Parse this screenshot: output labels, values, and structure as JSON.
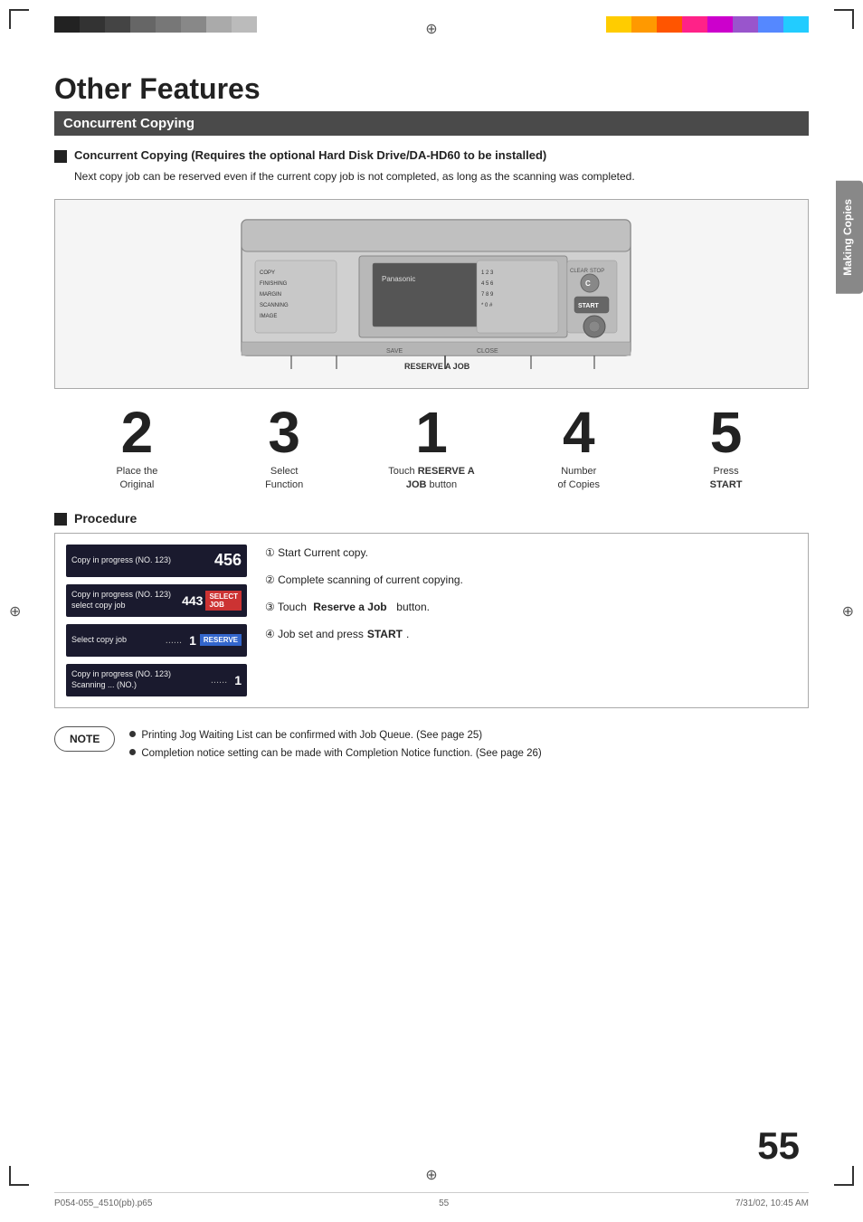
{
  "topBars": {
    "left": [
      "#222",
      "#333",
      "#555",
      "#777",
      "#666",
      "#888",
      "#aaa",
      "#bbb"
    ],
    "right": [
      "#ffcc00",
      "#ff9900",
      "#ff6600",
      "#ff3399",
      "#cc00cc",
      "#9966cc",
      "#6699ff",
      "#33ccff"
    ]
  },
  "page": {
    "title": "Other Features",
    "sectionHeader": "Concurrent Copying",
    "pageNumber": "55"
  },
  "feature": {
    "heading": "Concurrent Copying (Requires the optional Hard Disk Drive/DA-HD60 to be installed)",
    "description": "Next copy job can be reserved even if the current copy job is not completed, as long as the scanning was completed."
  },
  "steps": [
    {
      "number": "2",
      "label": "Place the\nOriginal"
    },
    {
      "number": "3",
      "label": "Select\nFunction"
    },
    {
      "number": "1",
      "label": "Touch RESERVE A\nJOB button"
    },
    {
      "number": "4",
      "label": "Number\nof Copies"
    },
    {
      "number": "5",
      "label": "Press\nSTART"
    }
  ],
  "procedure": {
    "heading": "Procedure",
    "screens": [
      {
        "text": "Copy in progress (NO. 123)",
        "value": "456",
        "badge": ""
      },
      {
        "text": "Copy in progress (NO. 123)\nselect copy job",
        "value": "443",
        "badge": "SELECT JOB"
      },
      {
        "text": "Select copy job",
        "value": "1",
        "badge": "RESERVE"
      },
      {
        "text": "Copy in progress (NO. 123)\nScanning ... (NO.)",
        "value": "1",
        "badge": ""
      }
    ],
    "steps": [
      "① Start Current copy.",
      "② Complete scanning of current copying.",
      "③ Touch Reserve a Job button.",
      "④ Job set and press START."
    ]
  },
  "note": {
    "label": "NOTE",
    "items": [
      "Printing Jog Waiting List can be confirmed with Job Queue. (See page 25)",
      "Completion notice setting can be made with Completion Notice function. (See page 26)"
    ]
  },
  "sideTab": "Making Copies",
  "footer": {
    "left": "P054-055_4510(pb).p65",
    "center": "55",
    "right": "7/31/02, 10:45 AM"
  }
}
